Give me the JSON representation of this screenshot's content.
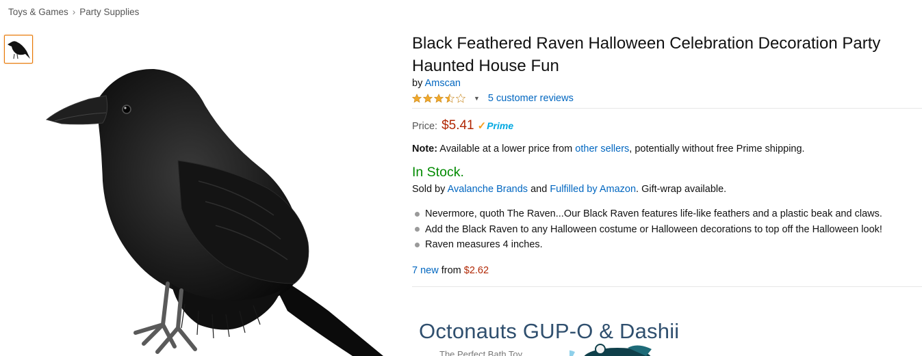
{
  "breadcrumb": {
    "items": [
      "Toys & Games",
      "Party Supplies"
    ],
    "separator": "›"
  },
  "product": {
    "title": "Black Feathered Raven Halloween Celebration Decoration Party Haunted House Fun",
    "by_label": "by",
    "brand": "Amscan",
    "rating": 3.5,
    "reviews_link": "5 customer reviews",
    "price_label": "Price:",
    "price": "$5.41",
    "prime_label": "Prime",
    "note_label": "Note:",
    "note_pre": "Available at a lower price from",
    "note_link": "other sellers",
    "note_post": ", potentially without free Prime shipping.",
    "stock": "In Stock.",
    "sold_by_pre": "Sold by",
    "seller": "Avalanche Brands",
    "sold_and": "and",
    "fulfilled": "Fulfilled by Amazon",
    "sold_post": ". Gift-wrap available.",
    "bullets": [
      "Nevermore, quoth The Raven...Our Black Raven features life-like feathers and a plastic beak and claws.",
      "Add the Black Raven to any Halloween costume or Halloween decorations to top off the Halloween look!",
      "Raven measures 4 inches."
    ],
    "offers_link": "7 new",
    "offers_from": "from",
    "offers_price": "$2.62"
  },
  "ad": {
    "title": "Octonauts GUP-O & Dashii",
    "subtitle": "The Perfect Bath Toy"
  },
  "colors": {
    "price": "#b12704",
    "link": "#0066c0",
    "stock": "#008a00",
    "star": "#f0a92c",
    "thumb_border": "#e77600"
  },
  "icons": {
    "thumb": "raven-thumbnail",
    "stars": "star-rating-icon",
    "prime": "prime-check-icon"
  }
}
